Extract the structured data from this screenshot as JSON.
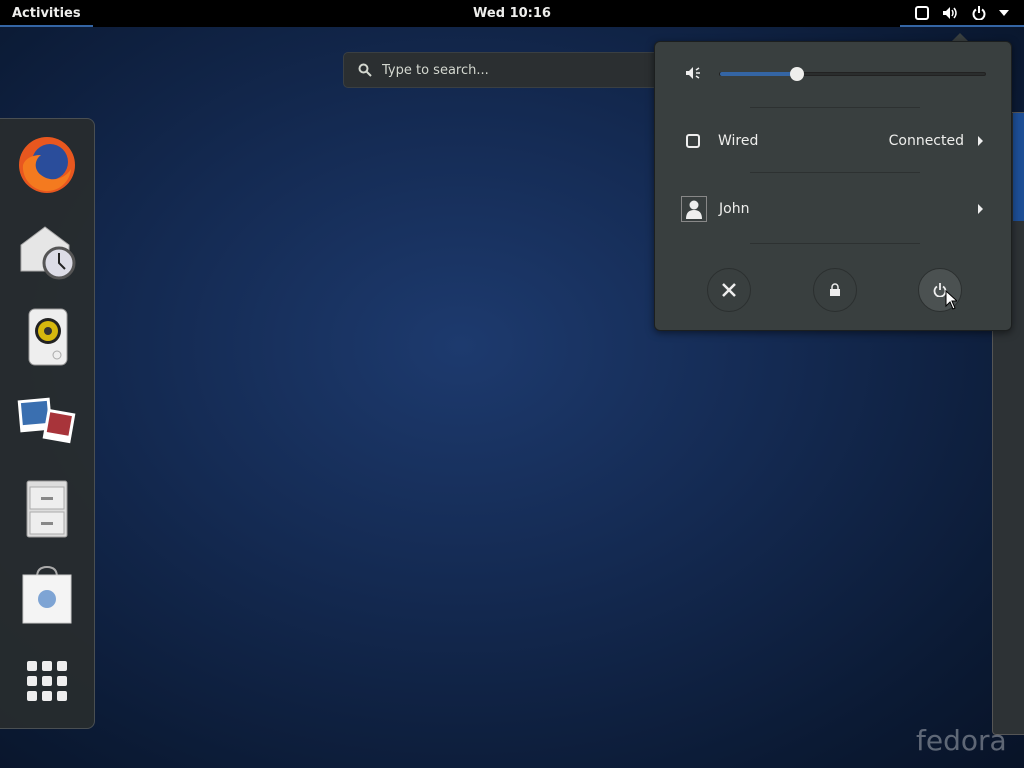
{
  "topbar": {
    "activities": "Activities",
    "clock": "Wed 10:16",
    "icons": [
      "network-wired-icon",
      "volume-icon",
      "power-icon",
      "dropdown-arrow-icon"
    ]
  },
  "search": {
    "placeholder": "Type to search..."
  },
  "dash": {
    "apps": [
      "Firefox",
      "Evolution",
      "Rhythmbox",
      "Shotwell",
      "Files",
      "Software"
    ],
    "show_apps": "show-apps-icon"
  },
  "menu": {
    "volume_percent": 29,
    "network_label": "Wired",
    "network_status": "Connected",
    "user": "John",
    "buttons": [
      "settings",
      "lock",
      "power-off"
    ]
  },
  "watermark": "fedora",
  "colors": {
    "accent": "#3465a4",
    "panel": "#000000",
    "popup": "#393f3f"
  }
}
